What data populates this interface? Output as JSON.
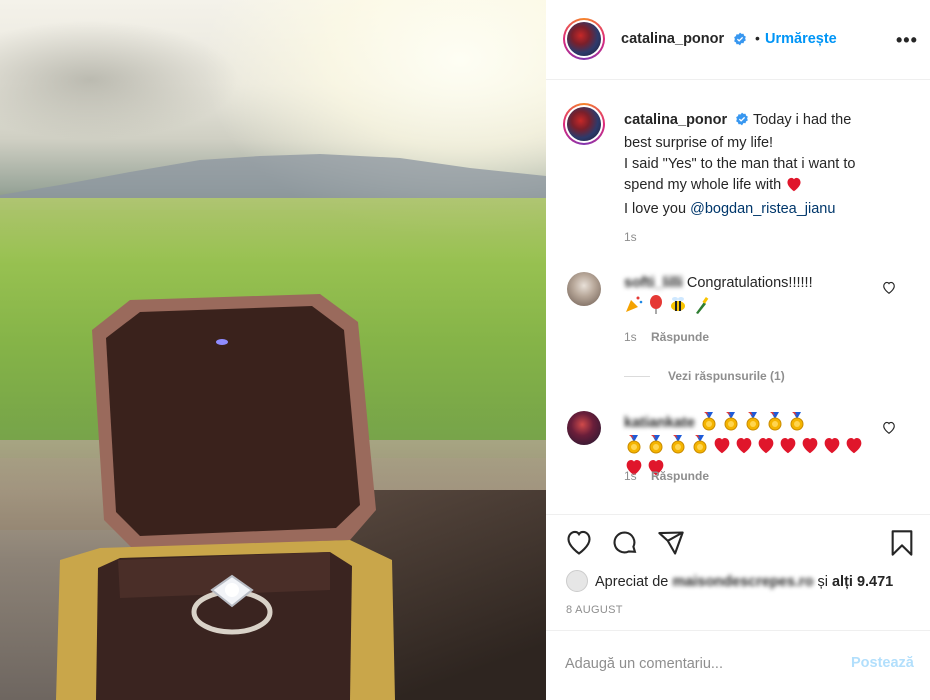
{
  "post": {
    "author": "catalina_ponor",
    "follow_label": "Urmărește",
    "dot": "•",
    "more_label": "•••"
  },
  "caption": {
    "username": "catalina_ponor",
    "line1": "Today i had the",
    "line2": "best surprise of my life!",
    "line3": "I said \"Yes\" to the man that i want to",
    "line4": "spend my whole life with",
    "line5_prefix": "I love you",
    "mention": "@bogdan_ristea_jianu",
    "time": "1s"
  },
  "comments": [
    {
      "username": "softi_lilli",
      "text": "Congratulations!!!!!!",
      "emojis": [
        "party-popper",
        "balloon",
        "bee",
        "champagne"
      ],
      "time": "1s",
      "reply_label": "Răspunde",
      "view_replies": "Vezi răspunsurile (1)"
    },
    {
      "username": "katiankate",
      "emojis_line1": [
        "medal",
        "medal",
        "medal",
        "medal",
        "medal"
      ],
      "emojis_line2": [
        "medal",
        "medal",
        "medal",
        "medal",
        "heart",
        "heart",
        "heart",
        "heart",
        "heart",
        "heart",
        "heart",
        "heart",
        "heart"
      ],
      "time": "1s",
      "reply_label": "Răspunde"
    }
  ],
  "likes": {
    "prefix": "Apreciat de",
    "liker": "maisondescrepes.ro",
    "suffix_and": "și",
    "others": "alți 9.471"
  },
  "date": "8 AUGUST",
  "comment_box": {
    "placeholder": "Adaugă un comentariu...",
    "post_label": "Postează"
  },
  "colors": {
    "accent": "#0095f6",
    "mention": "#00376b",
    "muted": "#8e8e8e",
    "post_disabled": "#b2dffc",
    "heart": "#ed4956"
  },
  "icons": [
    "verified-icon",
    "more-icon",
    "heart-icon",
    "comment-icon",
    "share-icon",
    "save-icon",
    "like-comment-icon"
  ]
}
